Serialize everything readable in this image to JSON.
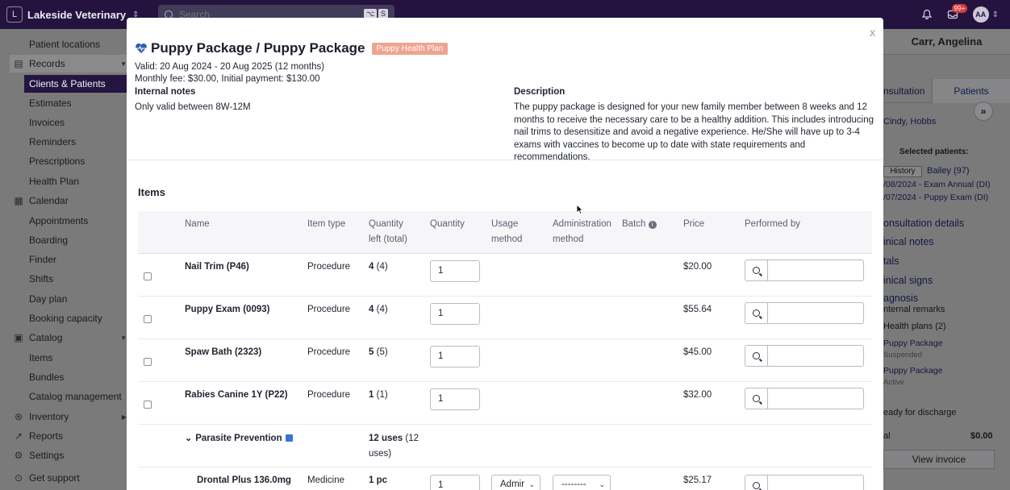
{
  "topbar": {
    "clinic_initial": "L",
    "clinic_name": "Lakeside Veterinary Cli...",
    "search_placeholder": "Search",
    "kbd1": "⌥",
    "kbd2": "S",
    "notif_count": "99+",
    "avatar": "AA"
  },
  "sidebar": {
    "items": [
      {
        "label": "Patient locations"
      },
      {
        "label": "Records"
      },
      {
        "label": "Clients & Patients"
      },
      {
        "label": "Estimates"
      },
      {
        "label": "Invoices"
      },
      {
        "label": "Reminders"
      },
      {
        "label": "Prescriptions"
      },
      {
        "label": "Health Plan"
      },
      {
        "label": "Calendar"
      },
      {
        "label": "Appointments"
      },
      {
        "label": "Boarding"
      },
      {
        "label": "Finder"
      },
      {
        "label": "Shifts"
      },
      {
        "label": "Day plan"
      },
      {
        "label": "Booking capacity"
      },
      {
        "label": "Catalog"
      },
      {
        "label": "Items"
      },
      {
        "label": "Bundles"
      },
      {
        "label": "Catalog management"
      },
      {
        "label": "Inventory"
      },
      {
        "label": "Reports"
      },
      {
        "label": "Settings"
      },
      {
        "label": "Get support"
      }
    ]
  },
  "right_panel": {
    "client_name": "Carr, Angelina",
    "tab_consultation": "nsultation",
    "tab_patients": "Patients",
    "client_link": "Cindy, Hobbs",
    "selected_label": "Selected patients:",
    "history": "History",
    "patient": "Bailey (97)",
    "visit1": "/08/2024 - Exam Annual (DI)",
    "visit2": "/07/2024 - Puppy Exam (DI)",
    "consult_details": "onsultation details",
    "clinical_notes": "inical notes",
    "vitals": "tals",
    "clinical_signs": "inical signs",
    "diagnosis": "agnosis",
    "internal_remarks": "nternal remarks",
    "health_plans": "Health plans (2)",
    "hp1": "Puppy Package",
    "hp1_status": "Suspended",
    "hp2": "Puppy Package",
    "hp2_status": "Active",
    "discharge": "eady for discharge",
    "total_label": "al",
    "total_value": "$0.00",
    "view_invoice": "View invoice"
  },
  "modal": {
    "close": "x",
    "title": "Puppy Package / Puppy Package",
    "badge": "Puppy Health Plan",
    "valid": "Valid: 20 Aug 2024 - 20 Aug 2025 (12 months)",
    "fees": "Monthly fee: $30.00, Initial payment: $130.00",
    "internal_notes_label": "Internal notes",
    "internal_notes": "Only valid between 8W-12M",
    "description_label": "Description",
    "description": "The puppy package is designed for your new family member between 8 weeks and 12 months to receive the necessary care to be a healthy addition. This includes introducing nail trims to desensitize and avoid a negative experience. He/She will have up to 3-4 exams with vaccines to become up to date with state requirements and recommendations.",
    "items_title": "Items",
    "headers": {
      "name": "Name",
      "item_type": "Item type",
      "qty_left_1": "Quantity",
      "qty_left_2": "left (total)",
      "quantity": "Quantity",
      "usage_1": "Usage",
      "usage_2": "method",
      "admin_1": "Administration",
      "admin_2": "method",
      "batch": "Batch",
      "price": "Price",
      "performed_by": "Performed by"
    },
    "rows": [
      {
        "name": "Nail Trim (P46)",
        "type": "Procedure",
        "left": "4",
        "total": "(4)",
        "qty": "1",
        "price": "$20.00"
      },
      {
        "name": "Puppy Exam (0093)",
        "type": "Procedure",
        "left": "4",
        "total": "(4)",
        "qty": "1",
        "price": "$55.64"
      },
      {
        "name": "Spaw Bath (2323)",
        "type": "Procedure",
        "left": "5",
        "total": "(5)",
        "qty": "1",
        "price": "$45.00"
      },
      {
        "name": "Rabies Canine 1Y (P22)",
        "type": "Procedure",
        "left": "1",
        "total": "(1)",
        "qty": "1",
        "price": "$32.00"
      }
    ],
    "bundle": {
      "name": "Parasite Prevention",
      "uses_bold": "12 uses",
      "uses_rest": "(12",
      "uses_line2": "uses)"
    },
    "sub_row": {
      "name": "Drontal Plus 136.0mg",
      "type": "Medicine",
      "left": "1 pc",
      "qty": "1",
      "usage": "Admir",
      "admin": "--------",
      "price": "$25.17"
    }
  }
}
